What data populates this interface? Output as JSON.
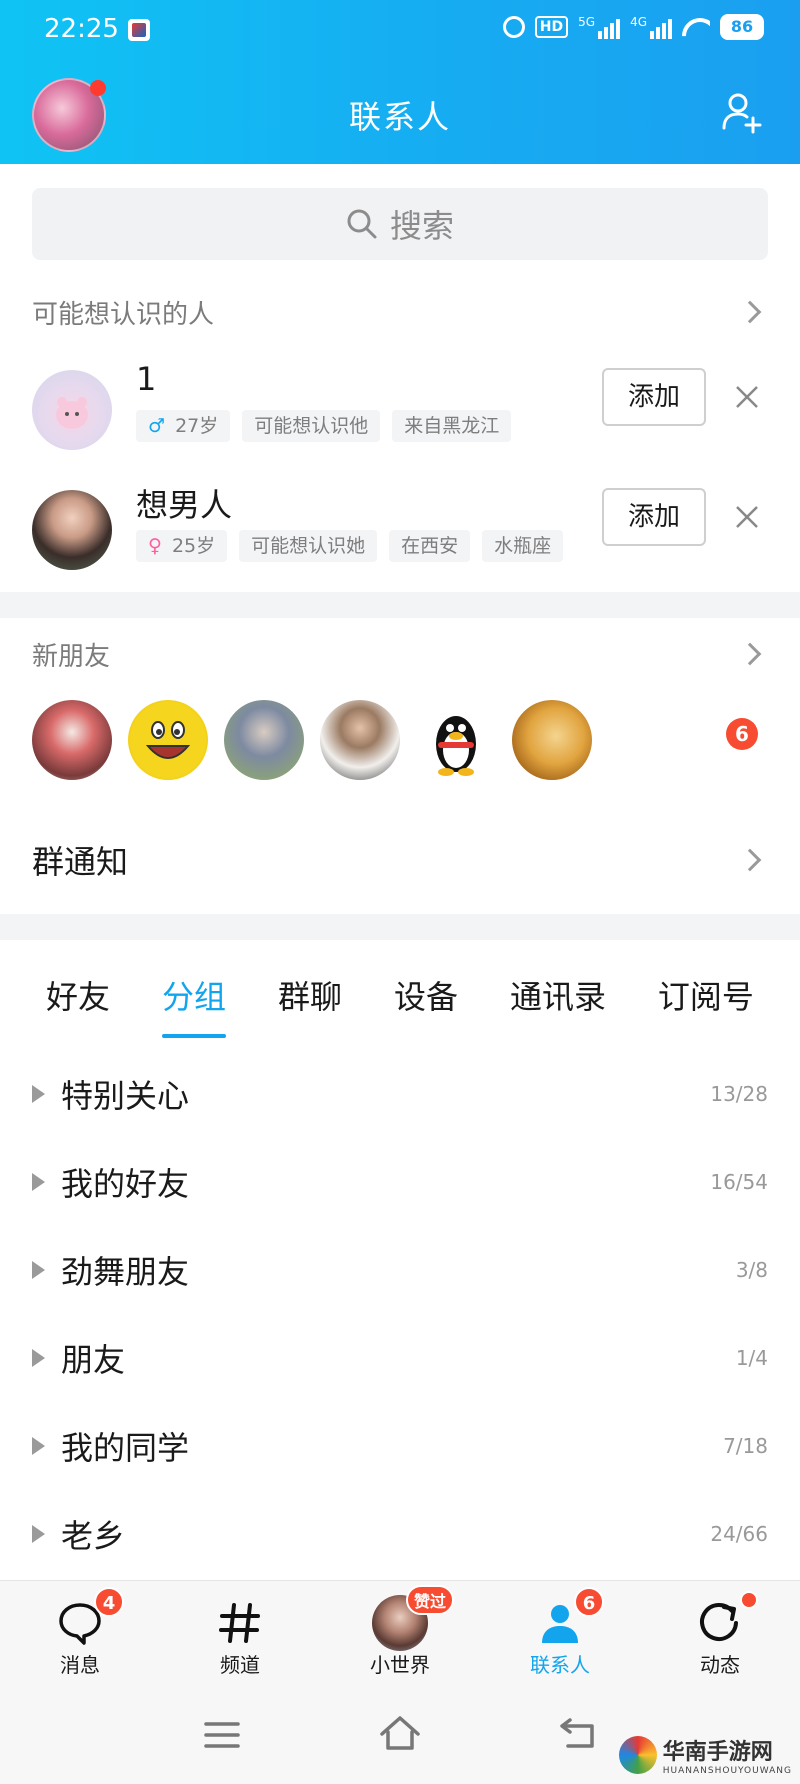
{
  "status_bar": {
    "time": "22:25",
    "hd": "HD",
    "net_5g": "5G",
    "net_4g": "4G",
    "battery": "86"
  },
  "header": {
    "title": "联系人",
    "avatar_has_dot": true
  },
  "search": {
    "placeholder": "搜索"
  },
  "suggestions": {
    "title": "可能想认识的人",
    "items": [
      {
        "name": "1",
        "tags": [
          "♂ 27岁",
          "可能想认识他",
          "来自黑龙江"
        ],
        "add_label": "添加"
      },
      {
        "name": "想男人",
        "tags": [
          "♀ 25岁",
          "可能想认识她",
          "在西安",
          "水瓶座"
        ],
        "add_label": "添加"
      }
    ]
  },
  "new_friends": {
    "title": "新朋友",
    "badge": "6"
  },
  "group_notice": {
    "title": "群通知"
  },
  "tabs": [
    "好友",
    "分组",
    "群聊",
    "设备",
    "通讯录",
    "订阅号"
  ],
  "active_tab": "分组",
  "groups": [
    {
      "name": "特别关心",
      "count": "13/28"
    },
    {
      "name": "我的好友",
      "count": "16/54"
    },
    {
      "name": "劲舞朋友",
      "count": "3/8"
    },
    {
      "name": "朋友",
      "count": "1/4"
    },
    {
      "name": "我的同学",
      "count": "7/18"
    },
    {
      "name": "老乡",
      "count": "24/66"
    }
  ],
  "bottom_nav": [
    {
      "label": "消息",
      "badge": "4"
    },
    {
      "label": "频道"
    },
    {
      "label": "小世界",
      "badge": "赞过"
    },
    {
      "label": "联系人",
      "badge": "6"
    },
    {
      "label": "动态",
      "dot": true
    }
  ],
  "watermark": {
    "name": "华南手游网",
    "sub": "HUANANSHOUYOUWANG"
  },
  "colors": {
    "accent": "#12a5ee",
    "header_start": "#0fc4f4",
    "header_end": "#1a9ff0",
    "badge": "#f74c31"
  }
}
